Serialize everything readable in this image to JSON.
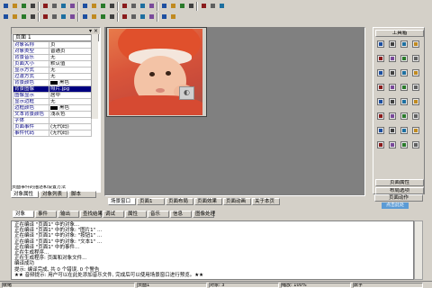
{
  "colors": {
    "face": "#d4d0c8",
    "canvas_bg": "#808080",
    "selection": "#000080",
    "hint_blue": "#5b9bd5"
  },
  "toolbar": {
    "row1_icons": [
      "new-icon",
      "open-icon",
      "save-icon",
      "print-icon",
      "cut-icon",
      "copy-icon",
      "paste-icon",
      "undo-icon",
      "redo-icon",
      "find-icon",
      "table-icon",
      "grid-icon",
      "image-icon",
      "music-icon",
      "play-icon",
      "run-icon",
      "stop-icon",
      "align-icon",
      "layout-icon",
      "frame-icon",
      "step-icon",
      "pause-icon",
      "end-icon"
    ],
    "row2_icons": [
      "select-icon",
      "text-icon",
      "button-icon",
      "check-icon",
      "radio-icon",
      "list-icon",
      "combo-icon",
      "edit-icon",
      "align-left-icon",
      "align-center-icon",
      "align-right-icon",
      "bold-icon",
      "italic-icon",
      "underline-icon",
      "color-icon",
      "font-icon",
      "size-icon",
      "zoom-icon"
    ]
  },
  "property_panel": {
    "selected_object": "页面 1",
    "rows": [
      {
        "name": "对象名称",
        "value": "页"
      },
      {
        "name": "对象类型",
        "value": "普通页"
      },
      {
        "name": "背景音乐",
        "value": "无"
      },
      {
        "name": "页面大小",
        "value": "默认值"
      },
      {
        "name": "显示方式",
        "value": "无"
      },
      {
        "name": "过渡方式",
        "value": "无"
      },
      {
        "name": "背景颜色",
        "value": "黑色"
      },
      {
        "name": "背景图像",
        "value": "照片.jpg"
      },
      {
        "name": "图像显示",
        "value": "居中"
      },
      {
        "name": "显示边框",
        "value": "无"
      },
      {
        "name": "边框颜色",
        "value": "黑色"
      },
      {
        "name": "文本背景颜色",
        "value": "浅灰色"
      },
      {
        "name": "字体",
        "value": ""
      },
      {
        "name": "页面事件",
        "value": "(无代码)"
      },
      {
        "name": "事件代码",
        "value": "(无代码)"
      }
    ],
    "selected_row_index": 7,
    "bottom_label": "页面事件的描述和设置方法",
    "tabs": [
      "对象属性",
      "对象列表",
      "脚本"
    ]
  },
  "canvas": {
    "float_button_icon": "rotate-icon"
  },
  "scene_tabs": [
    "场景窗口",
    "页面1",
    "页面布局",
    "页面效果",
    "页面动画",
    "关于本页"
  ],
  "toolbox": {
    "title": "工具箱",
    "tool_icons": [
      "pointer-icon",
      "text-tool-icon",
      "image-tool-icon",
      "shape-icon",
      "button-tool-icon",
      "line-icon",
      "rect-icon",
      "ellipse-icon",
      "video-icon",
      "audio-icon",
      "flash-icon",
      "web-icon",
      "table-tool-icon",
      "chart-icon",
      "timer-icon",
      "input-icon",
      "check-tool-icon",
      "list-tool-icon",
      "menu-icon",
      "tree-icon",
      "slider-icon",
      "progress-icon",
      "label-icon",
      "frame-tool-icon",
      "scroll-icon",
      "group-icon",
      "hotspot-icon",
      "link-icon",
      "dice-icon",
      "clock-icon",
      "calendar-icon",
      "note-icon"
    ],
    "footer_items": [
      "页面属性",
      "布局选项",
      "页面动作"
    ],
    "hint_label": "点击此处"
  },
  "output": {
    "tabs": [
      "对象",
      "事件",
      "输出",
      "查找结果",
      "调试",
      "属性",
      "音乐",
      "信息",
      "图像处理"
    ],
    "lines": [
      "正在编译 \"页面1\" 中的对象...",
      "正在编译 \"页面1\" 中的对象: \"图片1\" ...",
      "正在编译 \"页面1\" 中的对象: \"按钮1\" ...",
      "正在编译 \"页面1\" 中的对象: \"文本1\" ...",
      "正在编译 \"页面1\" 中的事件...",
      "正在生成程序...",
      "正在生成程序: 页面和对象文件...",
      "编译成功",
      "提示: 编译完成, 共 0 个错误, 0 个警告",
      "★★ 音频提示: 用户可以在此处添加音乐文件, 完成后可以使用场景窗口进行预览。★★"
    ]
  },
  "statusbar": [
    "就绪",
    "页面1",
    "对象: 3",
    "缩放: 100%",
    "数字"
  ]
}
